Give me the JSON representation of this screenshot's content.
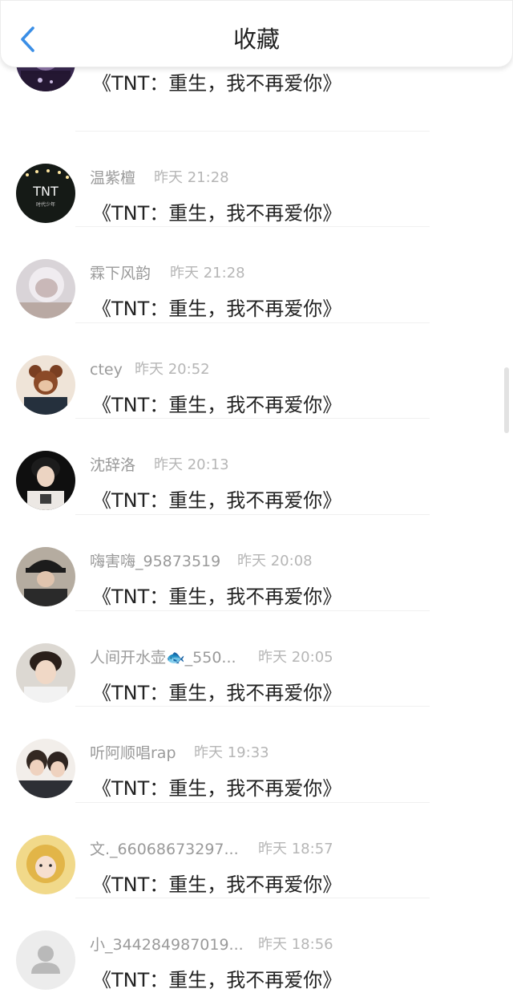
{
  "header": {
    "title": "收藏",
    "back_icon": "chevron-left-icon",
    "accent": "#3a8ee6"
  },
  "items": [
    {
      "name": "",
      "time": "",
      "title": "《TNT：重生，我不再爱你》",
      "avatar": "purple-portrait"
    },
    {
      "name": "温紫檀",
      "time": "昨天 21:28",
      "title": "《TNT：重生，我不再爱你》",
      "avatar": "tnt-logo"
    },
    {
      "name": "霖下风韵",
      "time": "昨天 21:28",
      "title": "《TNT：重生，我不再爱你》",
      "avatar": "hooded-portrait"
    },
    {
      "name": "ctey",
      "time": "昨天 20:52",
      "title": "《TNT：重生，我不再爱你》",
      "avatar": "bear-ears-portrait"
    },
    {
      "name": "沈辞洛",
      "time": "昨天 20:13",
      "title": "《TNT：重生，我不再爱你》",
      "avatar": "dark-hair-portrait"
    },
    {
      "name": "嗨害嗨_95873519",
      "time": "昨天 20:08",
      "title": "《TNT：重生，我不再爱你》",
      "avatar": "bucket-hat-portrait"
    },
    {
      "name": "人间开水壶🐟_550...",
      "time": "昨天 20:05",
      "title": "《TNT：重生，我不再爱你》",
      "avatar": "smiling-portrait"
    },
    {
      "name": "听阿顺唱rap",
      "time": "昨天 19:33",
      "title": "《TNT：重生，我不再爱你》",
      "avatar": "group-portrait"
    },
    {
      "name": "文._66068673297...",
      "time": "昨天 18:57",
      "title": "《TNT：重生，我不再爱你》",
      "avatar": "yellow-hood-portrait"
    },
    {
      "name": "小_344284987019...",
      "time": "昨天 18:56",
      "title": "《TNT：重生，我不再爱你》",
      "avatar": "default-user-icon"
    }
  ]
}
